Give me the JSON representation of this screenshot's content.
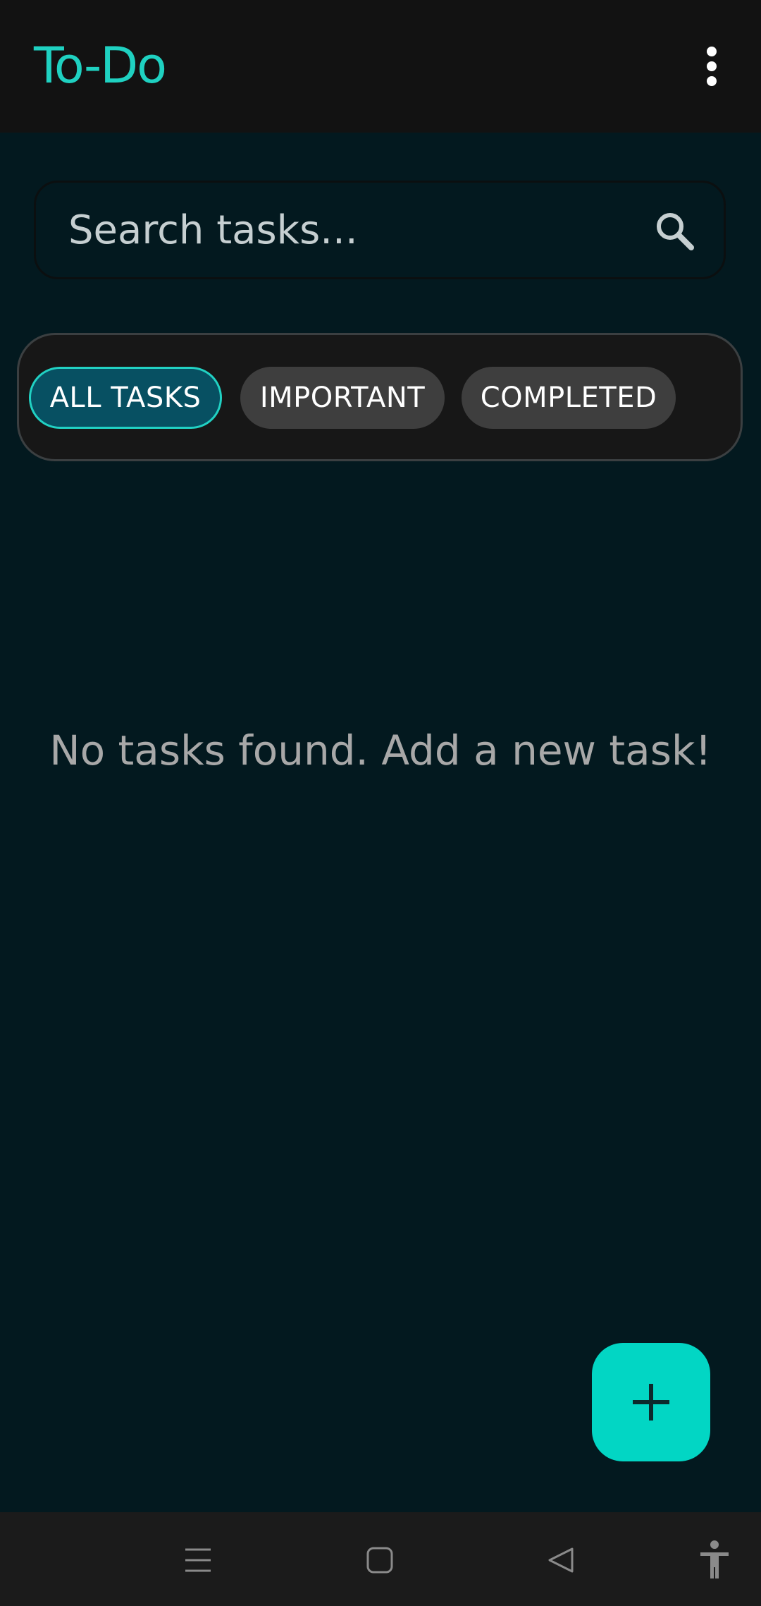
{
  "app": {
    "title": "To-Do",
    "accent_color": "#1fd1c1"
  },
  "appbar": {
    "menu_icon": "more-vertical-icon"
  },
  "search": {
    "placeholder": "Search tasks...",
    "value": "",
    "icon": "search-icon"
  },
  "filters": {
    "selected": "ALL TASKS",
    "items": [
      {
        "label": "ALL TASKS",
        "active": true
      },
      {
        "label": "IMPORTANT",
        "active": false
      },
      {
        "label": "COMPLETED",
        "active": false
      }
    ]
  },
  "main": {
    "empty_message": "No tasks found. Add a new task!"
  },
  "fab": {
    "icon": "plus-icon",
    "color": "#02d6c4"
  },
  "navbar": {
    "icons": [
      "recent-apps-icon",
      "home-icon",
      "back-icon",
      "accessibility-icon"
    ]
  }
}
